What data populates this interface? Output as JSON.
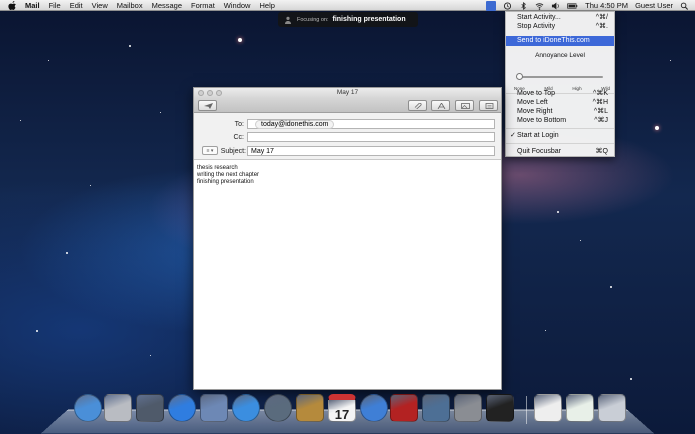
{
  "menubar": {
    "app_name": "Mail",
    "items": [
      "File",
      "Edit",
      "View",
      "Mailbox",
      "Message",
      "Format",
      "Window",
      "Help"
    ],
    "clock": "Thu 4:50 PM",
    "user": "Guest User"
  },
  "focus_hud": {
    "prefix": "Focusing on:",
    "task": "finishing presentation"
  },
  "focusbar_menu": {
    "items": [
      {
        "label": "Start Activity...",
        "shortcut": "^⌘/"
      },
      {
        "label": "Stop Activity",
        "shortcut": "^⌘."
      },
      {
        "label": "Send to iDoneThis.com",
        "shortcut": ""
      },
      {
        "label": "Move to Top",
        "shortcut": "^⌘K"
      },
      {
        "label": "Move Left",
        "shortcut": "^⌘H"
      },
      {
        "label": "Move Right",
        "shortcut": "^⌘L"
      },
      {
        "label": "Move to Bottom",
        "shortcut": "^⌘J"
      },
      {
        "label": "Start at Login",
        "shortcut": ""
      },
      {
        "label": "Quit Focusbar",
        "shortcut": "⌘Q"
      }
    ],
    "annoyance_label": "Annoyance Level",
    "annoyance_ticks": [
      "None",
      "Mild",
      "High",
      "Wild"
    ],
    "annoyance_value": 0,
    "start_at_login_checked": true,
    "check_glyph": "✓",
    "highlight_color": "#3d68d8"
  },
  "mail_window": {
    "title": "May 17",
    "to_label": "To:",
    "to_value": "today@idonethis.com",
    "cc_label": "Cc:",
    "cc_value": "",
    "subject_label": "Subject:",
    "subject_value": "May 17",
    "body_lines": [
      "thesis research",
      "writing the next chapter",
      "finishing presentation"
    ]
  },
  "dock": {
    "apps": [
      {
        "name": "finder-icon",
        "color": "#4a8fd8"
      },
      {
        "name": "launchpad-icon",
        "color": "#b9bcc2"
      },
      {
        "name": "mission-control-icon",
        "color": "#4f5a6a"
      },
      {
        "name": "app-store-icon",
        "color": "#2f7de0"
      },
      {
        "name": "preview-icon",
        "color": "#6d88b5"
      },
      {
        "name": "safari-icon",
        "color": "#3b8ee0"
      },
      {
        "name": "facetime-icon",
        "color": "#5a6b7d"
      },
      {
        "name": "address-book-icon",
        "color": "#b58a3c"
      },
      {
        "name": "ical-icon",
        "color": "#f4f4f4"
      },
      {
        "name": "itunes-icon",
        "color": "#3f7fd6"
      },
      {
        "name": "photo-booth-icon",
        "color": "#b32222"
      },
      {
        "name": "iphoto-icon",
        "color": "#4d6f95"
      },
      {
        "name": "system-preferences-icon",
        "color": "#8a8d93"
      },
      {
        "name": "terminal-icon",
        "color": "#222222"
      },
      {
        "name": "document-icon",
        "color": "#eeeeee"
      },
      {
        "name": "document-2-icon",
        "color": "#e8f0e8"
      },
      {
        "name": "trash-icon",
        "color": "#c9ced6"
      }
    ],
    "ical_date": "17"
  }
}
